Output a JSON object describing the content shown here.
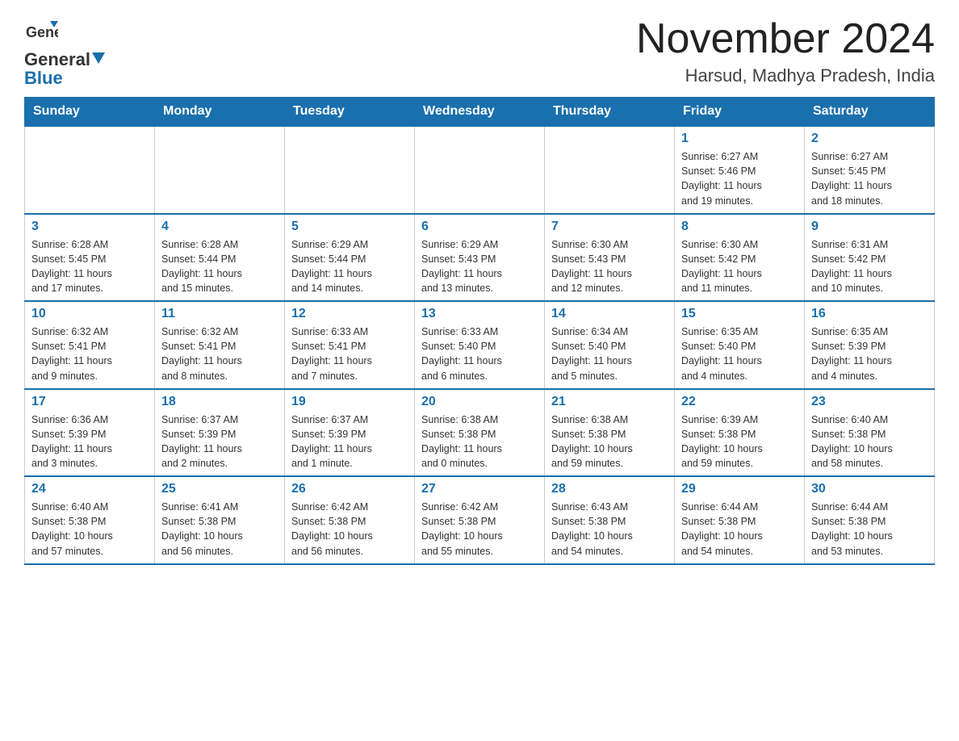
{
  "header": {
    "logo_line1": "General",
    "logo_line2": "Blue",
    "month_title": "November 2024",
    "location": "Harsud, Madhya Pradesh, India"
  },
  "days_of_week": [
    "Sunday",
    "Monday",
    "Tuesday",
    "Wednesday",
    "Thursday",
    "Friday",
    "Saturday"
  ],
  "weeks": [
    [
      {
        "day": "",
        "info": ""
      },
      {
        "day": "",
        "info": ""
      },
      {
        "day": "",
        "info": ""
      },
      {
        "day": "",
        "info": ""
      },
      {
        "day": "",
        "info": ""
      },
      {
        "day": "1",
        "info": "Sunrise: 6:27 AM\nSunset: 5:46 PM\nDaylight: 11 hours\nand 19 minutes."
      },
      {
        "day": "2",
        "info": "Sunrise: 6:27 AM\nSunset: 5:45 PM\nDaylight: 11 hours\nand 18 minutes."
      }
    ],
    [
      {
        "day": "3",
        "info": "Sunrise: 6:28 AM\nSunset: 5:45 PM\nDaylight: 11 hours\nand 17 minutes."
      },
      {
        "day": "4",
        "info": "Sunrise: 6:28 AM\nSunset: 5:44 PM\nDaylight: 11 hours\nand 15 minutes."
      },
      {
        "day": "5",
        "info": "Sunrise: 6:29 AM\nSunset: 5:44 PM\nDaylight: 11 hours\nand 14 minutes."
      },
      {
        "day": "6",
        "info": "Sunrise: 6:29 AM\nSunset: 5:43 PM\nDaylight: 11 hours\nand 13 minutes."
      },
      {
        "day": "7",
        "info": "Sunrise: 6:30 AM\nSunset: 5:43 PM\nDaylight: 11 hours\nand 12 minutes."
      },
      {
        "day": "8",
        "info": "Sunrise: 6:30 AM\nSunset: 5:42 PM\nDaylight: 11 hours\nand 11 minutes."
      },
      {
        "day": "9",
        "info": "Sunrise: 6:31 AM\nSunset: 5:42 PM\nDaylight: 11 hours\nand 10 minutes."
      }
    ],
    [
      {
        "day": "10",
        "info": "Sunrise: 6:32 AM\nSunset: 5:41 PM\nDaylight: 11 hours\nand 9 minutes."
      },
      {
        "day": "11",
        "info": "Sunrise: 6:32 AM\nSunset: 5:41 PM\nDaylight: 11 hours\nand 8 minutes."
      },
      {
        "day": "12",
        "info": "Sunrise: 6:33 AM\nSunset: 5:41 PM\nDaylight: 11 hours\nand 7 minutes."
      },
      {
        "day": "13",
        "info": "Sunrise: 6:33 AM\nSunset: 5:40 PM\nDaylight: 11 hours\nand 6 minutes."
      },
      {
        "day": "14",
        "info": "Sunrise: 6:34 AM\nSunset: 5:40 PM\nDaylight: 11 hours\nand 5 minutes."
      },
      {
        "day": "15",
        "info": "Sunrise: 6:35 AM\nSunset: 5:40 PM\nDaylight: 11 hours\nand 4 minutes."
      },
      {
        "day": "16",
        "info": "Sunrise: 6:35 AM\nSunset: 5:39 PM\nDaylight: 11 hours\nand 4 minutes."
      }
    ],
    [
      {
        "day": "17",
        "info": "Sunrise: 6:36 AM\nSunset: 5:39 PM\nDaylight: 11 hours\nand 3 minutes."
      },
      {
        "day": "18",
        "info": "Sunrise: 6:37 AM\nSunset: 5:39 PM\nDaylight: 11 hours\nand 2 minutes."
      },
      {
        "day": "19",
        "info": "Sunrise: 6:37 AM\nSunset: 5:39 PM\nDaylight: 11 hours\nand 1 minute."
      },
      {
        "day": "20",
        "info": "Sunrise: 6:38 AM\nSunset: 5:38 PM\nDaylight: 11 hours\nand 0 minutes."
      },
      {
        "day": "21",
        "info": "Sunrise: 6:38 AM\nSunset: 5:38 PM\nDaylight: 10 hours\nand 59 minutes."
      },
      {
        "day": "22",
        "info": "Sunrise: 6:39 AM\nSunset: 5:38 PM\nDaylight: 10 hours\nand 59 minutes."
      },
      {
        "day": "23",
        "info": "Sunrise: 6:40 AM\nSunset: 5:38 PM\nDaylight: 10 hours\nand 58 minutes."
      }
    ],
    [
      {
        "day": "24",
        "info": "Sunrise: 6:40 AM\nSunset: 5:38 PM\nDaylight: 10 hours\nand 57 minutes."
      },
      {
        "day": "25",
        "info": "Sunrise: 6:41 AM\nSunset: 5:38 PM\nDaylight: 10 hours\nand 56 minutes."
      },
      {
        "day": "26",
        "info": "Sunrise: 6:42 AM\nSunset: 5:38 PM\nDaylight: 10 hours\nand 56 minutes."
      },
      {
        "day": "27",
        "info": "Sunrise: 6:42 AM\nSunset: 5:38 PM\nDaylight: 10 hours\nand 55 minutes."
      },
      {
        "day": "28",
        "info": "Sunrise: 6:43 AM\nSunset: 5:38 PM\nDaylight: 10 hours\nand 54 minutes."
      },
      {
        "day": "29",
        "info": "Sunrise: 6:44 AM\nSunset: 5:38 PM\nDaylight: 10 hours\nand 54 minutes."
      },
      {
        "day": "30",
        "info": "Sunrise: 6:44 AM\nSunset: 5:38 PM\nDaylight: 10 hours\nand 53 minutes."
      }
    ]
  ]
}
